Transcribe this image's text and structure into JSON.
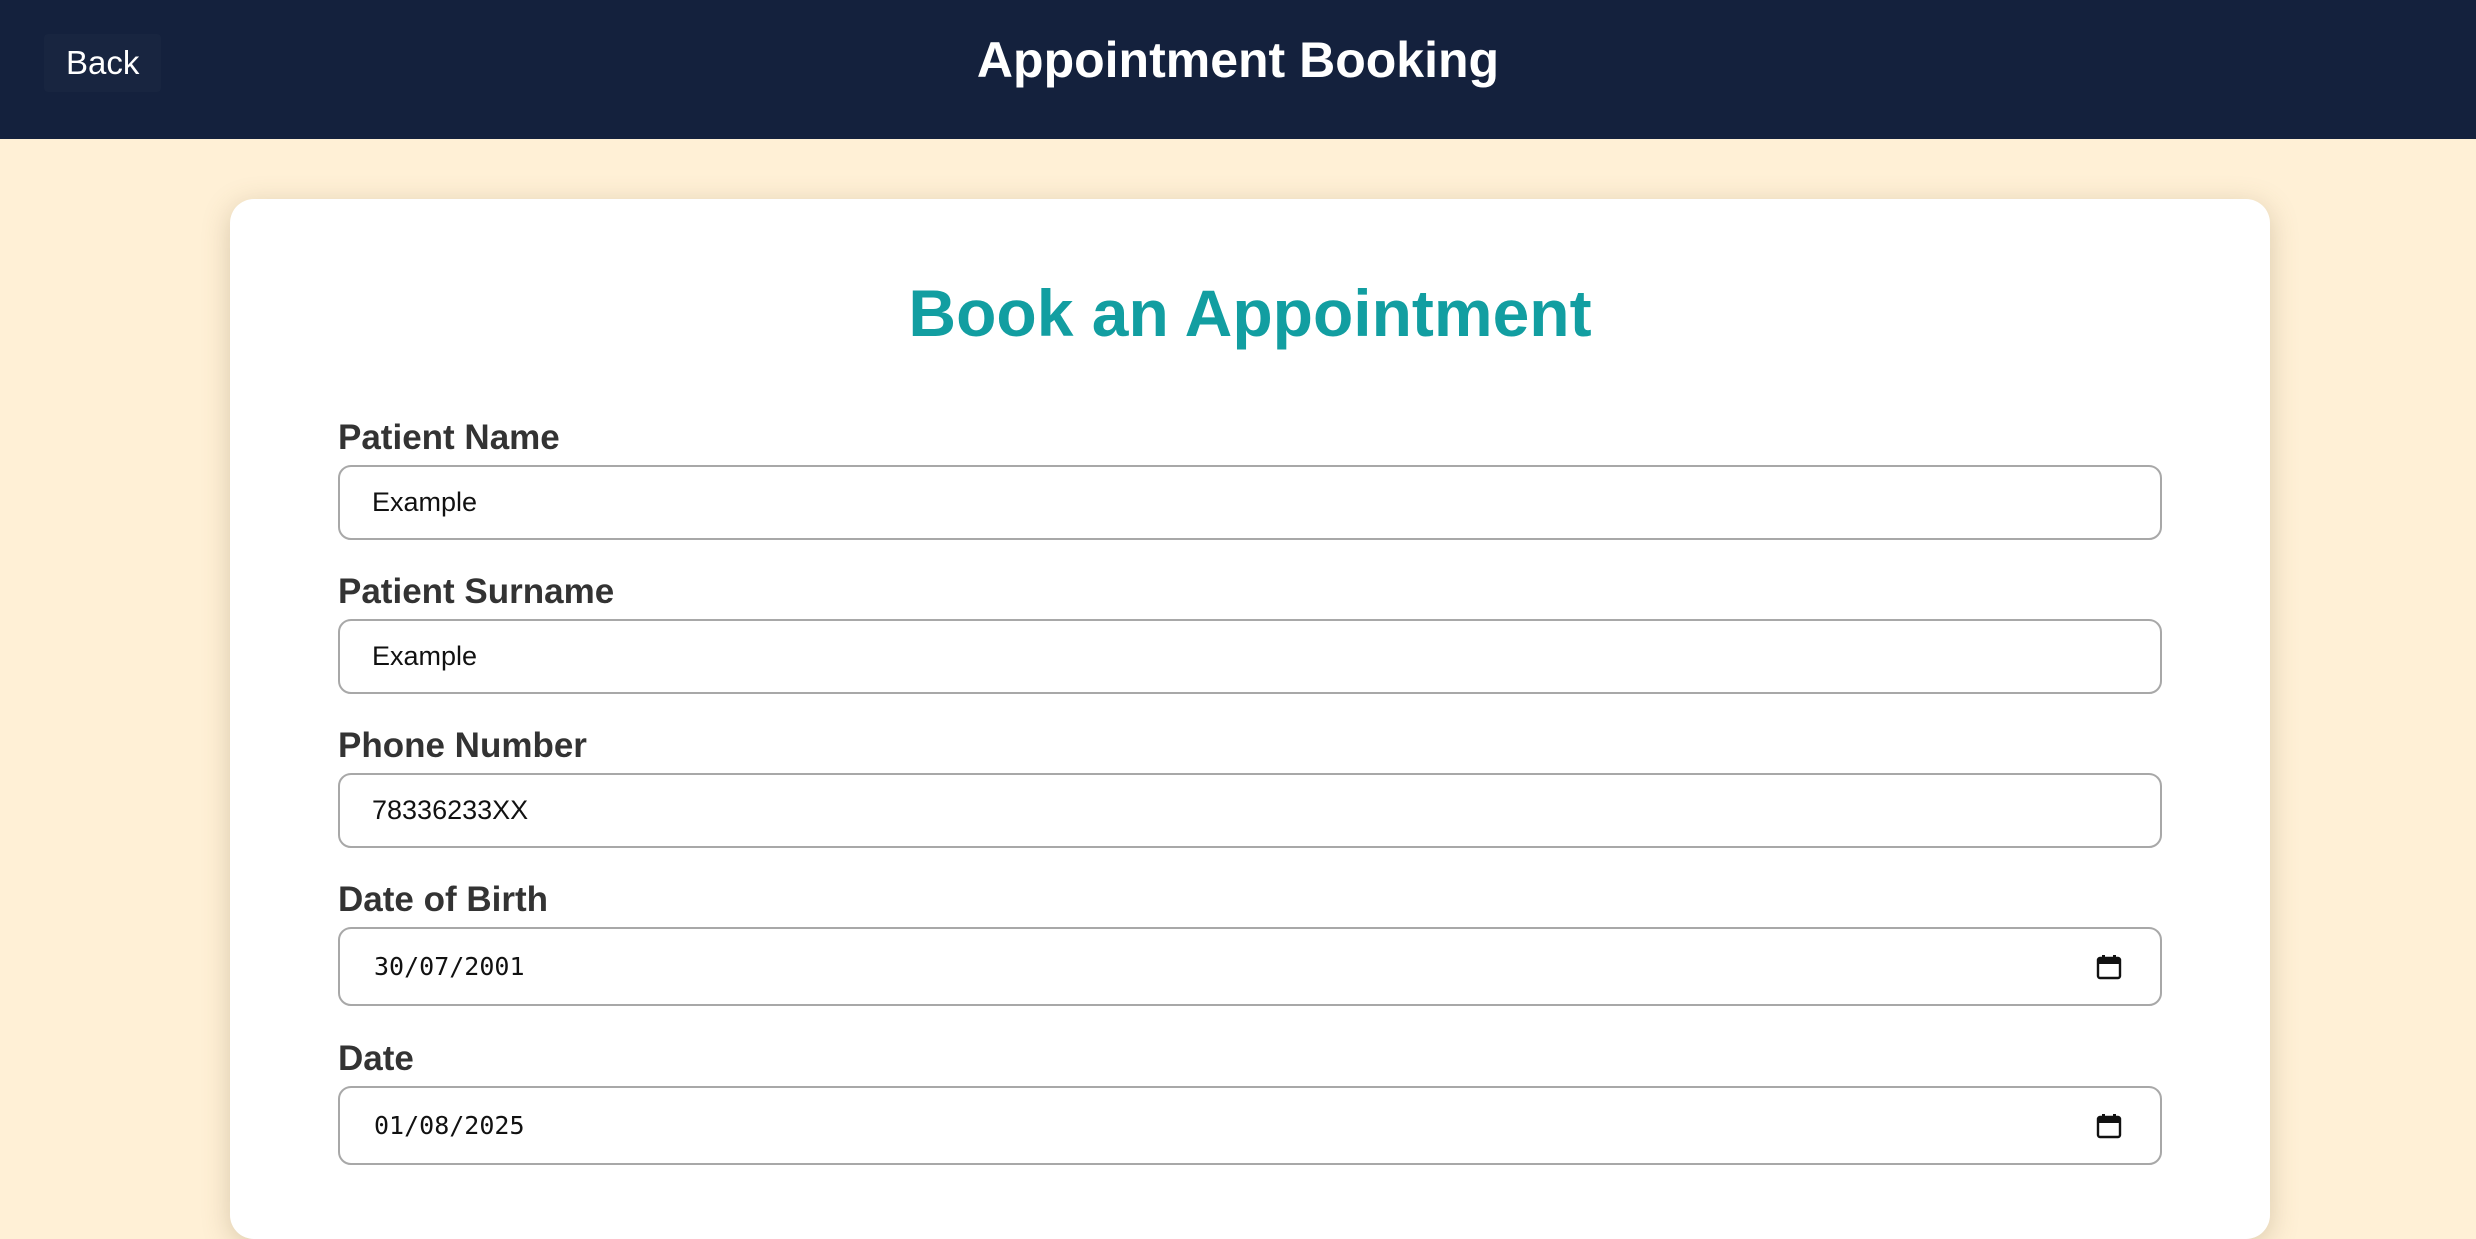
{
  "header": {
    "back_label": "Back",
    "title": "Appointment Booking"
  },
  "form": {
    "title": "Book an Appointment",
    "fields": [
      {
        "label": "Patient Name",
        "value": "Example",
        "type": "text"
      },
      {
        "label": "Patient Surname",
        "value": "Example",
        "type": "text"
      },
      {
        "label": "Phone Number",
        "value": "78336233XX",
        "type": "tel"
      },
      {
        "label": "Date of Birth",
        "value": "30/07/2001",
        "type": "date",
        "icon": "calendar-icon"
      },
      {
        "label": "Date",
        "value": "01/08/2025",
        "type": "date",
        "icon": "calendar-icon"
      }
    ]
  },
  "colors": {
    "header_bg": "#14213d",
    "page_bg": "#fff0d6",
    "accent": "#129ea1",
    "label_text": "#333333"
  }
}
